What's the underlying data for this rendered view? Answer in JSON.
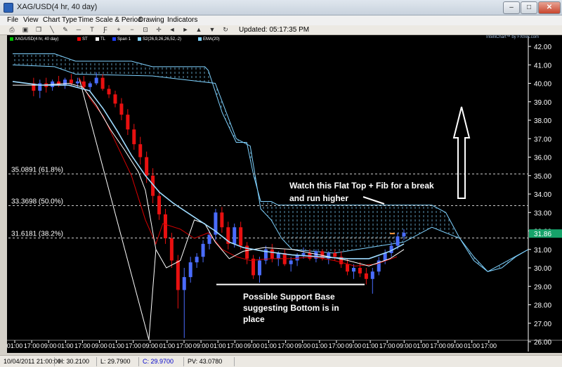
{
  "window": {
    "title": "XAG/USD(4 hr,  40 day)"
  },
  "menu": [
    "File",
    "View",
    "Chart Type",
    "Time Scale & Period",
    "Drawing",
    "Indicators"
  ],
  "toolbar": {
    "icons": [
      "print-icon",
      "save-icon",
      "copy-icon",
      "line-tool-icon",
      "draw-tool-icon",
      "hline-icon",
      "text-tool-icon",
      "fib-tool-icon",
      "zoom-in-icon",
      "zoom-out-icon",
      "zoom-fit-icon",
      "crosshair-icon",
      "scroll-left-icon",
      "scroll-right-icon",
      "scroll-up-icon",
      "scroll-down-icon",
      "refresh-icon"
    ],
    "updated": "Updated: 05:17:35 PM"
  },
  "legend": [
    {
      "label": "XAG/USD(4 hr, 40 day)",
      "color": "#00c000"
    },
    {
      "label": "ST",
      "color": "#ff0000"
    },
    {
      "label": "TL",
      "color": "#ffffff"
    },
    {
      "label": "Span 1",
      "color": "#1f3fff"
    },
    {
      "label": "S2(26,9,26,26,52,-2)",
      "color": "#7fd2ff"
    },
    {
      "label": "EMA(20)",
      "color": "#7fd2ff"
    }
  ],
  "watermark": "IntelliChart™ by FXtrek.com",
  "current_price_label": "31.86",
  "chart_data": {
    "type": "candlestick",
    "y_axis": {
      "min": 26.0,
      "max": 42.0,
      "ticks": [
        "26.00",
        "27.00",
        "28.00",
        "29.00",
        "30.00",
        "31.00",
        "32.00",
        "33.00",
        "34.00",
        "35.00",
        "36.00",
        "37.00",
        "38.00",
        "39.00",
        "40.00",
        "41.00",
        "42.00"
      ]
    },
    "x_axis": {
      "ticks": [
        "01:00",
        "17:00",
        "09:00",
        "01:00",
        "17:00",
        "09:00",
        "01:00",
        "17:00",
        "09:00",
        "01:00",
        "17:00",
        "09:00",
        "01:00",
        "17:00",
        "09:00",
        "01:00",
        "17:00",
        "09:00",
        "01:00",
        "17:00",
        "09:00",
        "01:00",
        "17:00",
        "09:00",
        "01:00",
        "17:00",
        "09:00",
        "01:00",
        "17:00"
      ]
    },
    "fib_levels": [
      {
        "label": "35.0891 (61.8%)",
        "value": 35.0891
      },
      {
        "label": "33.3698 (50.0%)",
        "value": 33.3698
      },
      {
        "label": "31.6181 (38.2%)",
        "value": 31.6181
      }
    ],
    "support_level": 29.1,
    "annotations": {
      "flat_top": [
        "Watch this Flat Top + Fib for a break",
        "and run higher"
      ],
      "support": [
        "Possible Support Base",
        "suggesting Bottom is in",
        "place"
      ]
    },
    "candles": [
      {
        "o": 40.0,
        "h": 40.3,
        "l": 39.3,
        "c": 39.6
      },
      {
        "o": 39.6,
        "h": 40.2,
        "l": 39.2,
        "c": 40.0
      },
      {
        "o": 40.0,
        "h": 40.3,
        "l": 39.5,
        "c": 39.8
      },
      {
        "o": 39.8,
        "h": 40.2,
        "l": 39.6,
        "c": 40.1
      },
      {
        "o": 40.1,
        "h": 40.4,
        "l": 39.8,
        "c": 39.9
      },
      {
        "o": 39.9,
        "h": 40.3,
        "l": 39.7,
        "c": 40.2
      },
      {
        "o": 40.2,
        "h": 40.5,
        "l": 39.9,
        "c": 40.0
      },
      {
        "o": 40.0,
        "h": 40.3,
        "l": 39.8,
        "c": 40.1
      },
      {
        "o": 40.1,
        "h": 40.4,
        "l": 39.7,
        "c": 39.8
      },
      {
        "o": 39.8,
        "h": 40.1,
        "l": 39.6,
        "c": 40.0
      },
      {
        "o": 40.0,
        "h": 40.6,
        "l": 39.9,
        "c": 40.3
      },
      {
        "o": 40.3,
        "h": 40.5,
        "l": 39.6,
        "c": 39.7
      },
      {
        "o": 39.7,
        "h": 39.9,
        "l": 39.2,
        "c": 39.4
      },
      {
        "o": 39.4,
        "h": 39.6,
        "l": 38.7,
        "c": 38.9
      },
      {
        "o": 38.9,
        "h": 39.2,
        "l": 38.0,
        "c": 38.3
      },
      {
        "o": 38.3,
        "h": 38.6,
        "l": 37.2,
        "c": 37.5
      },
      {
        "o": 37.5,
        "h": 37.8,
        "l": 36.4,
        "c": 36.7
      },
      {
        "o": 36.7,
        "h": 37.1,
        "l": 35.6,
        "c": 36.0
      },
      {
        "o": 36.0,
        "h": 36.3,
        "l": 34.6,
        "c": 35.0
      },
      {
        "o": 35.0,
        "h": 35.4,
        "l": 33.5,
        "c": 33.9
      },
      {
        "o": 33.9,
        "h": 34.2,
        "l": 32.6,
        "c": 32.9
      },
      {
        "o": 32.9,
        "h": 33.2,
        "l": 31.3,
        "c": 31.6
      },
      {
        "o": 31.6,
        "h": 31.9,
        "l": 30.0,
        "c": 30.4
      },
      {
        "o": 30.4,
        "h": 30.7,
        "l": 27.8,
        "c": 28.8
      },
      {
        "o": 28.8,
        "h": 30.0,
        "l": 26.2,
        "c": 29.5
      },
      {
        "o": 29.5,
        "h": 30.6,
        "l": 29.2,
        "c": 30.3
      },
      {
        "o": 30.3,
        "h": 30.8,
        "l": 30.0,
        "c": 30.6
      },
      {
        "o": 30.6,
        "h": 31.5,
        "l": 30.3,
        "c": 31.3
      },
      {
        "o": 31.3,
        "h": 32.0,
        "l": 31.0,
        "c": 31.8
      },
      {
        "o": 31.8,
        "h": 33.2,
        "l": 31.5,
        "c": 33.0
      },
      {
        "o": 33.0,
        "h": 33.3,
        "l": 31.9,
        "c": 32.2
      },
      {
        "o": 32.2,
        "h": 32.5,
        "l": 31.0,
        "c": 31.3
      },
      {
        "o": 31.3,
        "h": 32.4,
        "l": 31.1,
        "c": 32.2
      },
      {
        "o": 32.2,
        "h": 32.5,
        "l": 31.0,
        "c": 31.2
      },
      {
        "o": 31.2,
        "h": 31.4,
        "l": 30.2,
        "c": 30.5
      },
      {
        "o": 30.5,
        "h": 30.7,
        "l": 29.4,
        "c": 29.6
      },
      {
        "o": 29.6,
        "h": 30.6,
        "l": 29.2,
        "c": 30.4
      },
      {
        "o": 30.4,
        "h": 31.2,
        "l": 30.2,
        "c": 31.0
      },
      {
        "o": 31.0,
        "h": 31.3,
        "l": 30.3,
        "c": 30.5
      },
      {
        "o": 30.5,
        "h": 30.9,
        "l": 30.1,
        "c": 30.8
      },
      {
        "o": 30.8,
        "h": 31.0,
        "l": 30.1,
        "c": 30.2
      },
      {
        "o": 30.2,
        "h": 30.6,
        "l": 29.8,
        "c": 30.4
      },
      {
        "o": 30.4,
        "h": 30.8,
        "l": 30.1,
        "c": 30.7
      },
      {
        "o": 30.7,
        "h": 31.1,
        "l": 30.5,
        "c": 30.8
      },
      {
        "o": 30.8,
        "h": 31.0,
        "l": 30.4,
        "c": 30.5
      },
      {
        "o": 30.5,
        "h": 31.0,
        "l": 30.3,
        "c": 30.9
      },
      {
        "o": 30.9,
        "h": 31.0,
        "l": 30.4,
        "c": 30.5
      },
      {
        "o": 30.5,
        "h": 30.9,
        "l": 30.2,
        "c": 30.8
      },
      {
        "o": 30.8,
        "h": 31.0,
        "l": 30.4,
        "c": 30.6
      },
      {
        "o": 30.6,
        "h": 30.9,
        "l": 30.0,
        "c": 30.2
      },
      {
        "o": 30.2,
        "h": 30.5,
        "l": 29.6,
        "c": 29.8
      },
      {
        "o": 29.8,
        "h": 30.2,
        "l": 29.4,
        "c": 30.0
      },
      {
        "o": 30.0,
        "h": 30.3,
        "l": 29.5,
        "c": 29.7
      },
      {
        "o": 29.7,
        "h": 30.0,
        "l": 29.1,
        "c": 29.4
      },
      {
        "o": 29.4,
        "h": 30.0,
        "l": 28.6,
        "c": 29.8
      },
      {
        "o": 29.8,
        "h": 30.6,
        "l": 29.6,
        "c": 30.4
      },
      {
        "o": 30.4,
        "h": 31.0,
        "l": 30.2,
        "c": 30.8
      },
      {
        "o": 30.8,
        "h": 31.4,
        "l": 30.6,
        "c": 31.2
      },
      {
        "o": 31.2,
        "h": 31.9,
        "l": 31.0,
        "c": 31.7
      },
      {
        "o": 31.7,
        "h": 32.1,
        "l": 31.5,
        "c": 31.9
      }
    ],
    "cloud_top": [
      [
        0,
        41.6
      ],
      [
        60,
        41.6
      ],
      [
        90,
        41.2
      ],
      [
        170,
        41.2
      ],
      [
        200,
        40.9
      ],
      [
        275,
        40.9
      ],
      [
        280,
        40.7
      ],
      [
        300,
        38.4
      ],
      [
        320,
        36.8
      ],
      [
        335,
        36.8
      ],
      [
        345,
        35.0
      ],
      [
        355,
        33.6
      ],
      [
        370,
        33.6
      ],
      [
        380,
        33.4
      ],
      [
        600,
        33.4
      ],
      [
        620,
        33.0
      ],
      [
        640,
        31.6
      ],
      [
        660,
        30.4
      ],
      [
        680,
        29.8
      ],
      [
        700,
        30.0
      ],
      [
        720,
        30.6
      ],
      [
        738,
        31.0
      ]
    ],
    "cloud_bottom": [
      [
        0,
        41.0
      ],
      [
        60,
        40.9
      ],
      [
        90,
        40.5
      ],
      [
        200,
        40.4
      ],
      [
        290,
        40.0
      ],
      [
        320,
        37.0
      ],
      [
        340,
        36.6
      ],
      [
        355,
        33.2
      ],
      [
        370,
        32.6
      ],
      [
        385,
        31.6
      ],
      [
        400,
        31.0
      ],
      [
        460,
        30.8
      ],
      [
        560,
        31.4
      ],
      [
        600,
        32.2
      ],
      [
        640,
        31.6
      ],
      [
        660,
        30.6
      ],
      [
        680,
        29.8
      ],
      [
        738,
        31.0
      ]
    ],
    "ema": [
      [
        0,
        40.1
      ],
      [
        40,
        39.9
      ],
      [
        80,
        39.9
      ],
      [
        110,
        39.6
      ],
      [
        130,
        38.6
      ],
      [
        150,
        37.4
      ],
      [
        170,
        36.1
      ],
      [
        190,
        35.0
      ],
      [
        210,
        34.1
      ],
      [
        230,
        33.5
      ],
      [
        250,
        33.0
      ],
      [
        270,
        32.5
      ],
      [
        290,
        32.0
      ],
      [
        310,
        31.4
      ],
      [
        330,
        31.1
      ],
      [
        360,
        30.9
      ],
      [
        400,
        30.7
      ],
      [
        440,
        30.6
      ],
      [
        480,
        30.5
      ],
      [
        510,
        30.5
      ],
      [
        540,
        30.9
      ],
      [
        560,
        31.3
      ]
    ],
    "white_line": [
      [
        0,
        39.9
      ],
      [
        40,
        39.9
      ],
      [
        80,
        40.0
      ],
      [
        100,
        39.8
      ],
      [
        120,
        38.8
      ],
      [
        140,
        37.5
      ],
      [
        160,
        36.4
      ],
      [
        180,
        35.2
      ],
      [
        190,
        34.2
      ],
      [
        205,
        31.0
      ],
      [
        220,
        30.0
      ],
      [
        240,
        30.4
      ],
      [
        260,
        32.6
      ],
      [
        275,
        32.4
      ],
      [
        290,
        31.4
      ],
      [
        310,
        30.5
      ],
      [
        330,
        30.9
      ],
      [
        360,
        31.1
      ],
      [
        400,
        31.0
      ],
      [
        440,
        30.7
      ],
      [
        480,
        30.4
      ],
      [
        510,
        30.1
      ],
      [
        540,
        30.5
      ],
      [
        560,
        31.0
      ]
    ],
    "red_line": [
      [
        95,
        40.3
      ],
      [
        110,
        39.2
      ],
      [
        130,
        38.2
      ],
      [
        150,
        36.6
      ],
      [
        170,
        35.0
      ],
      [
        180,
        33.8
      ],
      [
        190,
        32.6
      ],
      [
        205,
        31.3
      ],
      [
        215,
        32.4
      ],
      [
        240,
        32.1
      ],
      [
        260,
        31.6
      ],
      [
        280,
        31.9
      ],
      [
        300,
        31.0
      ],
      [
        320,
        30.6
      ],
      [
        340,
        30.4
      ],
      [
        370,
        30.5
      ],
      [
        400,
        30.5
      ],
      [
        430,
        30.6
      ],
      [
        460,
        30.4
      ],
      [
        490,
        30.1
      ],
      [
        520,
        30.2
      ],
      [
        550,
        30.6
      ]
    ],
    "triangle_lines": [
      [
        [
          95,
          40.3
        ],
        [
          195,
          26.1
        ]
      ],
      [
        [
          195,
          26.1
        ],
        [
          205,
          31.0
        ]
      ]
    ]
  },
  "status": {
    "date": "10/04/2011 21:00:00",
    "high": "H: 30.2100",
    "low": "L: 29.7900",
    "close": "C: 29.9700",
    "pv": "PV: 43.0780"
  }
}
